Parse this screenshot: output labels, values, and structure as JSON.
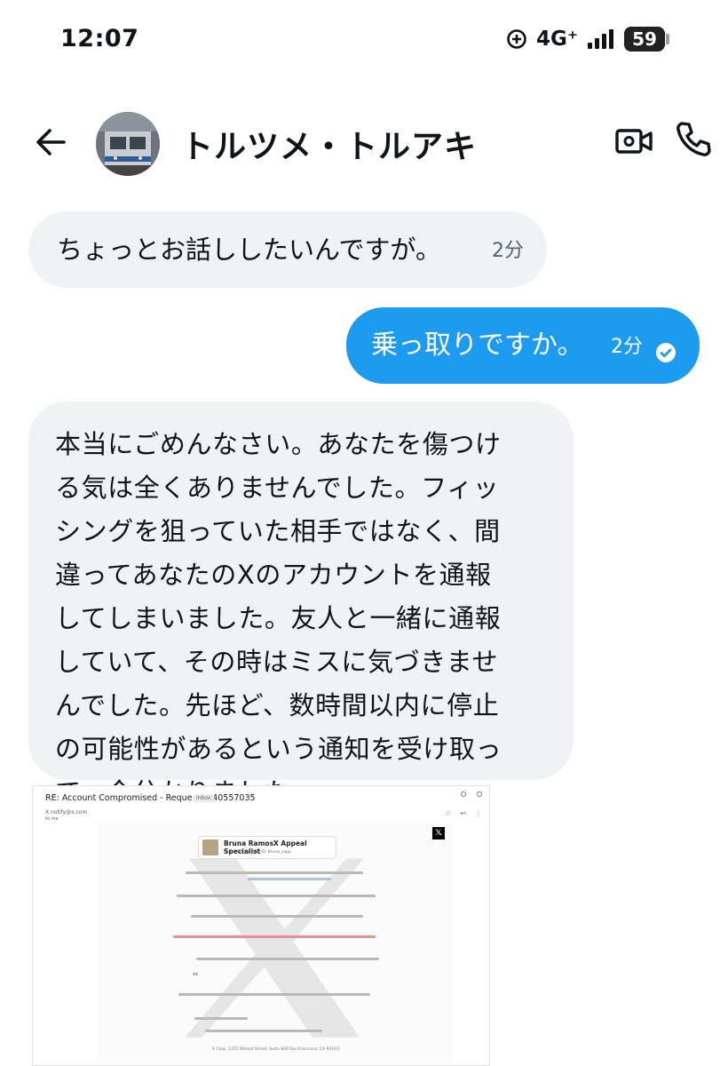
{
  "status_bar": {
    "time": "12:07",
    "network": "4G⁺",
    "battery": "59",
    "battery_level": 0.59
  },
  "header": {
    "contact_name": "トルツメ・トルアキ"
  },
  "messages": [
    {
      "direction": "incoming",
      "text": "ちょっとお話ししたいんですが。",
      "time": "2分"
    },
    {
      "direction": "outgoing",
      "text": "乗っ取りですか。",
      "time": "2分",
      "read": true
    },
    {
      "direction": "incoming",
      "text": "本当にごめんなさい。あなたを傷つけ\nる気は全くありませんでした。フィッ\nシングを狙っていた相手ではなく、間\n違ってあなたのXのアカウントを通報\nしてしまいました。友人と一緒に通報\nしていて、その時はミスに気づきませ\nんでした。先ほど、数時間以内に停止\nの可能性があるという通知を受け取っ\nて、今分かりました"
    }
  ],
  "attachment": {
    "subject": "RE: Account Compromised - Request # 40557035",
    "badge": "Inbox",
    "sender": "X notify@x.com",
    "to": "to me",
    "card_name": "Bruna RamosX Appeal Specialist",
    "card_sub": "Discord X Support ID: bruna_sxpp",
    "footer": "X Corp. 1355 Market Street, Suite 900 San Francisco, CA 94103",
    "colors": {
      "accent_red": "#e89090",
      "accent_blue": "#a8c4e6"
    }
  },
  "colors": {
    "outgoing_bubble": "#1d9bf0",
    "incoming_bubble": "#eff3f4",
    "timestamp": "#536471"
  }
}
